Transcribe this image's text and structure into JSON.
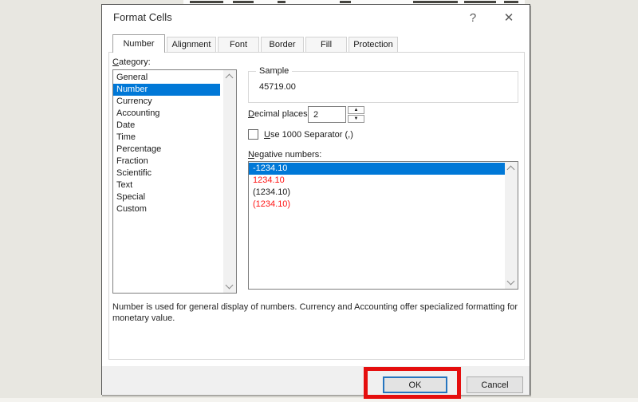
{
  "window": {
    "title": "Format Cells",
    "help_icon": "?",
    "close_icon": "✕"
  },
  "tabs": [
    {
      "label": "Number",
      "active": true
    },
    {
      "label": "Alignment",
      "active": false
    },
    {
      "label": "Font",
      "active": false
    },
    {
      "label": "Border",
      "active": false
    },
    {
      "label": "Fill",
      "active": false
    },
    {
      "label": "Protection",
      "active": false
    }
  ],
  "number_tab": {
    "category": {
      "label": "Category:",
      "selected": "Number",
      "items": [
        "General",
        "Number",
        "Currency",
        "Accounting",
        "Date",
        "Time",
        "Percentage",
        "Fraction",
        "Scientific",
        "Text",
        "Special",
        "Custom"
      ]
    },
    "sample": {
      "label": "Sample",
      "value": "45719.00"
    },
    "decimal_places": {
      "label": "Decimal places:",
      "value": "2"
    },
    "use_separator": {
      "label": "Use 1000 Separator (,)",
      "checked": false
    },
    "negative_numbers": {
      "label": "Negative numbers:",
      "selected_index": 0,
      "items": [
        {
          "text": "-1234.10",
          "style": "selected"
        },
        {
          "text": "1234.10",
          "style": "red"
        },
        {
          "text": "(1234.10)",
          "style": "black"
        },
        {
          "text": "(1234.10)",
          "style": "red"
        }
      ]
    },
    "description": "Number is used for general display of numbers.  Currency and Accounting offer specialized formatting for monetary value."
  },
  "footer": {
    "ok_label": "OK",
    "cancel_label": "Cancel"
  },
  "icons": {
    "help": "?",
    "close": "✕",
    "spinner_up": "▲",
    "spinner_down": "▼",
    "scrollbar_up": "chevron-up",
    "scrollbar_down": "chevron-down"
  },
  "annotation": {
    "type": "highlight-box",
    "target": "OK button",
    "color": "#e50e0e"
  },
  "colors": {
    "selection_blue": "#0078d7",
    "negative_red": "#ff1414",
    "ok_border_blue": "#2675bf",
    "page_background": "#e8e7e1"
  }
}
